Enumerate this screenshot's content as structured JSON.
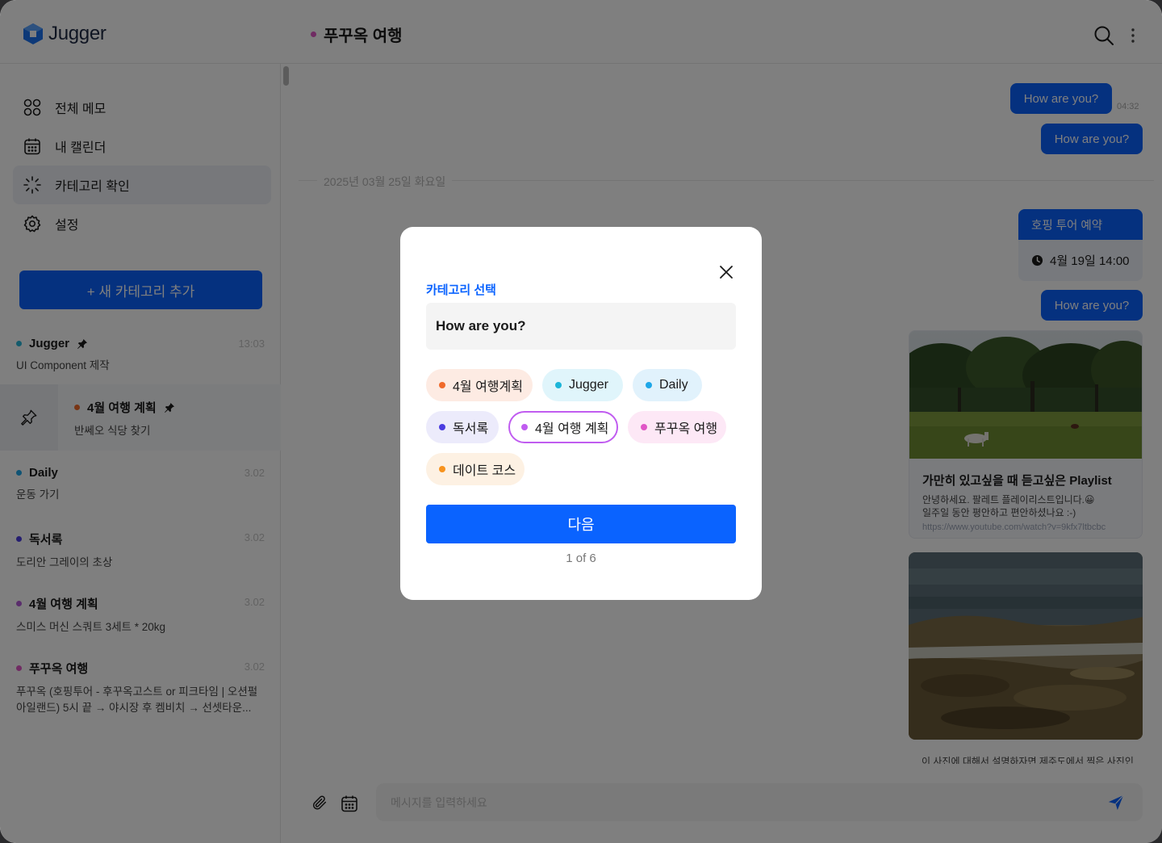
{
  "app": {
    "logo": "Jugger"
  },
  "header": {
    "chat_title": "푸꾸옥 여행",
    "chat_dot_color": "#e056c6"
  },
  "sidebar": {
    "nav": [
      {
        "label": "전체 메모",
        "icon": "grid-icon"
      },
      {
        "label": "내 캘린더",
        "icon": "calendar-icon"
      },
      {
        "label": "카테고리 확인",
        "icon": "loader-icon",
        "active": true
      },
      {
        "label": "설정",
        "icon": "gear-icon"
      }
    ],
    "add_button": "+ 새 카테고리 추가",
    "memos": [
      {
        "title": "Jugger",
        "time": "13:03",
        "subtitle": "UI Component 제작",
        "color": "#29b6d9",
        "pinned": true
      },
      {
        "title": "4월 여행 계획",
        "time": "",
        "subtitle": "반쎄오 식당 찾기",
        "color": "#f06a2b",
        "pinned": true
      },
      {
        "title": "Daily",
        "time": "3.02",
        "subtitle": "운동 가기",
        "color": "#1ea7e8"
      },
      {
        "title": "독서록",
        "time": "3.02",
        "subtitle": "도리안 그레이의 초상",
        "color": "#4a3ce0"
      },
      {
        "title": "4월 여행 계획",
        "time": "3.02",
        "subtitle": "스미스 머신 스쿼트 3세트 * 20kg",
        "color": "#b45ad8"
      },
      {
        "title": "푸꾸옥 여행",
        "time": "3.02",
        "subtitle": "푸꾸옥 (호핑투어 - 후꾸옥고스트 or 피크타임 | 오션펄 아일랜드) 5시 끝 → 야시장 후 켐비치 → 선셋타운...",
        "color": "#e056c6"
      }
    ]
  },
  "chat": {
    "messages": [
      {
        "text": "How are you?",
        "time": "04:32"
      },
      {
        "text": "How are you?"
      }
    ],
    "date_separator": "2025년 03월 25일 화요일",
    "tour": {
      "header": "호핑 투어 예약",
      "time": "4월 19일 14:00"
    },
    "message3": "How are you?",
    "link_card": {
      "title": "가만히 있고싶을 때 듣고싶은 Playlist",
      "desc1": "안녕하세요. 팔레트 플레이리스트입니다.😀",
      "desc2": "일주일 동안 평안하고 편안하셨나요 :-)",
      "url": "https://www.youtube.com/watch?v=9kfx7ltbcbc"
    },
    "photo_caption": "이 사진에 대해서 설명하자면 제주도에서 찍은 사진인",
    "composer_placeholder": "메시지를 입력하세요"
  },
  "modal": {
    "label": "카테고리 선택",
    "text": "How are you?",
    "categories": [
      {
        "label": "4월 여행계획",
        "color": "#f06a2b",
        "bg": "#fdebe3"
      },
      {
        "label": "Jugger",
        "color": "#1cb5d8",
        "bg": "#e0f5fb"
      },
      {
        "label": "Daily",
        "color": "#1ea7e8",
        "bg": "#e1f2fc"
      },
      {
        "label": "독서록",
        "color": "#4a3ce0",
        "bg": "#ecebfb"
      },
      {
        "label": "4월 여행 계획",
        "color": "#c05cf0",
        "bg": "#ffffff",
        "selected": true
      },
      {
        "label": "푸꾸옥 여행",
        "color": "#e056c6",
        "bg": "#fde8f6"
      },
      {
        "label": "데이트 코스",
        "color": "#f7931e",
        "bg": "#fdf1e3"
      }
    ],
    "next_button": "다음",
    "pager": "1 of 6"
  },
  "colors": {
    "accent": "#0a63ff"
  }
}
